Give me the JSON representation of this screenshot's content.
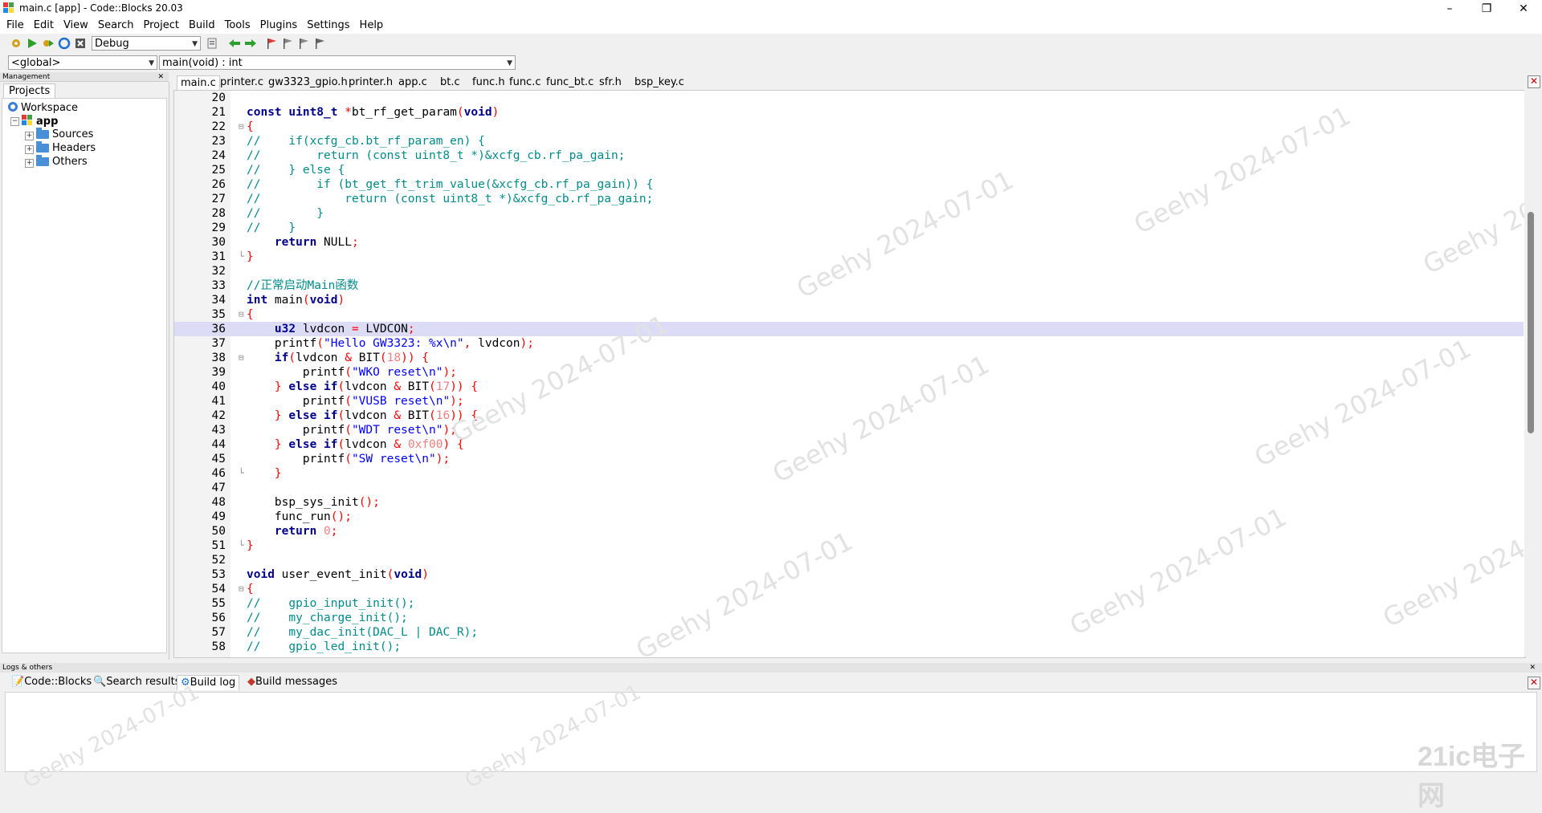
{
  "window": {
    "title": "main.c [app] - Code::Blocks 20.03",
    "minimize": "–",
    "maximize": "❐",
    "close": "✕"
  },
  "menu": [
    "File",
    "Edit",
    "View",
    "Search",
    "Project",
    "Build",
    "Tools",
    "Plugins",
    "Settings",
    "Help"
  ],
  "toolbar": {
    "build_target": "Debug"
  },
  "scope": {
    "scope_value": "<global>",
    "function_value": "main(void) : int"
  },
  "management": {
    "header": "Management",
    "tab": "Projects",
    "workspace": "Workspace",
    "project": "app",
    "folders": [
      "Sources",
      "Headers",
      "Others"
    ]
  },
  "editor_tabs": [
    "main.c",
    "printer.c",
    "gw3323_gpio.h",
    "printer.h",
    "app.c",
    "bt.c",
    "func.h",
    "func.c",
    "func_bt.c",
    "sfr.h",
    "bsp_key.c"
  ],
  "editor": {
    "current_line": 36,
    "lines": [
      {
        "n": "20",
        "code": ""
      },
      {
        "n": "21",
        "code": "<span class='kw'>const</span> <span class='kw'>uint8_t</span> <span class='op'>*</span>bt_rf_get_param<span class='op'>(</span><span class='kw'>void</span><span class='op'>)</span>"
      },
      {
        "n": "22",
        "code": "<span class='op'>{</span>",
        "fold": "⊟"
      },
      {
        "n": "23",
        "code": "<span class='cm'>//    if(xcfg_cb.bt_rf_param_en) {</span>"
      },
      {
        "n": "24",
        "code": "<span class='cm'>//        return (const uint8_t *)&amp;xcfg_cb.rf_pa_gain;</span>"
      },
      {
        "n": "25",
        "code": "<span class='cm'>//    } else {</span>"
      },
      {
        "n": "26",
        "code": "<span class='cm'>//        if (bt_get_ft_trim_value(&amp;xcfg_cb.rf_pa_gain)) {</span>"
      },
      {
        "n": "27",
        "code": "<span class='cm'>//            return (const uint8_t *)&amp;xcfg_cb.rf_pa_gain;</span>"
      },
      {
        "n": "28",
        "code": "<span class='cm'>//        }</span>"
      },
      {
        "n": "29",
        "code": "<span class='cm'>//    }</span>"
      },
      {
        "n": "30",
        "code": "    <span class='kw'>return</span> NULL<span class='op'>;</span>"
      },
      {
        "n": "31",
        "code": "<span class='op'>}</span>",
        "fold": "└"
      },
      {
        "n": "32",
        "code": ""
      },
      {
        "n": "33",
        "code": "<span class='cm'>//正常启动Main函数</span>"
      },
      {
        "n": "34",
        "code": "<span class='kw'>int</span> main<span class='op'>(</span><span class='kw'>void</span><span class='op'>)</span>"
      },
      {
        "n": "35",
        "code": "<span class='op'>{</span>",
        "fold": "⊟"
      },
      {
        "n": "36",
        "code": "    <span class='kw'>u32</span> lvdcon <span class='op'>=</span> LVDCON<span class='op'>;</span>"
      },
      {
        "n": "37",
        "code": "    printf<span class='op'>(</span><span class='str'>\"Hello GW3323: %x\\n\"</span><span class='op'>,</span> lvdcon<span class='op'>);</span>"
      },
      {
        "n": "38",
        "code": "    <span class='kw'>if</span><span class='op'>(</span>lvdcon <span class='op'>&amp;</span> BIT<span class='op'>(</span><span class='num'>18</span><span class='op'>))</span> <span class='op'>{</span>",
        "fold": "⊟"
      },
      {
        "n": "39",
        "code": "        printf<span class='op'>(</span><span class='str'>\"WKO reset\\n\"</span><span class='op'>);</span>"
      },
      {
        "n": "40",
        "code": "    <span class='op'>}</span> <span class='kw'>else if</span><span class='op'>(</span>lvdcon <span class='op'>&amp;</span> BIT<span class='op'>(</span><span class='num'>17</span><span class='op'>))</span> <span class='op'>{</span>"
      },
      {
        "n": "41",
        "code": "        printf<span class='op'>(</span><span class='str'>\"VUSB reset\\n\"</span><span class='op'>);</span>"
      },
      {
        "n": "42",
        "code": "    <span class='op'>}</span> <span class='kw'>else if</span><span class='op'>(</span>lvdcon <span class='op'>&amp;</span> BIT<span class='op'>(</span><span class='num'>16</span><span class='op'>))</span> <span class='op'>{</span>"
      },
      {
        "n": "43",
        "code": "        printf<span class='op'>(</span><span class='str'>\"WDT reset\\n\"</span><span class='op'>);</span>"
      },
      {
        "n": "44",
        "code": "    <span class='op'>}</span> <span class='kw'>else if</span><span class='op'>(</span>lvdcon <span class='op'>&amp;</span> <span class='num'>0xf00</span><span class='op'>)</span> <span class='op'>{</span>"
      },
      {
        "n": "45",
        "code": "        printf<span class='op'>(</span><span class='str'>\"SW reset\\n\"</span><span class='op'>);</span>"
      },
      {
        "n": "46",
        "code": "    <span class='op'>}</span>",
        "fold": "└"
      },
      {
        "n": "47",
        "code": ""
      },
      {
        "n": "48",
        "code": "    bsp_sys_init<span class='op'>();</span>"
      },
      {
        "n": "49",
        "code": "    func_run<span class='op'>();</span>"
      },
      {
        "n": "50",
        "code": "    <span class='kw'>return</span> <span class='num'>0</span><span class='op'>;</span>"
      },
      {
        "n": "51",
        "code": "<span class='op'>}</span>",
        "fold": "└"
      },
      {
        "n": "52",
        "code": ""
      },
      {
        "n": "53",
        "code": "<span class='kw'>void</span> user_event_init<span class='op'>(</span><span class='kw'>void</span><span class='op'>)</span>"
      },
      {
        "n": "54",
        "code": "<span class='op'>{</span>",
        "fold": "⊟"
      },
      {
        "n": "55",
        "code": "<span class='cm'>//    gpio_input_init();</span>"
      },
      {
        "n": "56",
        "code": "<span class='cm'>//    my_charge_init();</span>"
      },
      {
        "n": "57",
        "code": "<span class='cm'>//    my_dac_init(DAC_L | DAC_R);</span>"
      },
      {
        "n": "58",
        "code": "<span class='cm'>//    gpio_led_init();</span>"
      }
    ]
  },
  "logs": {
    "header": "Logs & others",
    "tabs": [
      "Code::Blocks",
      "Search results",
      "Build log",
      "Build messages"
    ],
    "active_tab": "Build log"
  },
  "watermark": "Geehy  2024-07-01",
  "brand_logo": "21ic电子网"
}
